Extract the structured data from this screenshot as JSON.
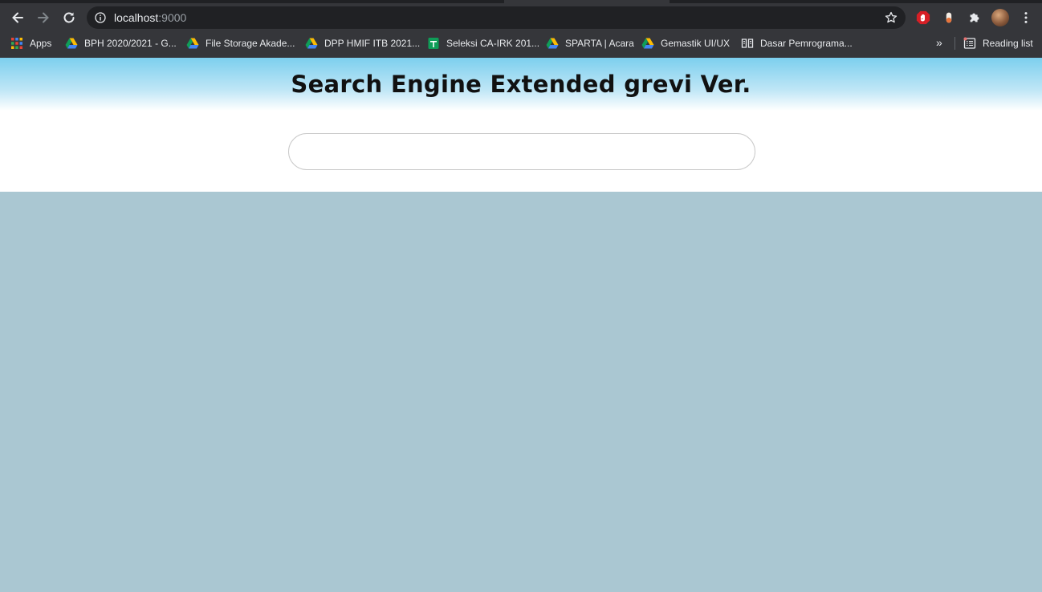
{
  "browser": {
    "url_host": "localhost",
    "url_port": ":9000",
    "bookmarks": [
      {
        "label": "Apps",
        "icon": "apps-grid-icon"
      },
      {
        "label": "BPH 2020/2021 - G...",
        "icon": "google-drive-icon"
      },
      {
        "label": "File Storage Akade...",
        "icon": "google-drive-icon"
      },
      {
        "label": "DPP HMIF ITB 2021...",
        "icon": "google-drive-icon"
      },
      {
        "label": "Seleksi CA-IRK 201...",
        "icon": "google-sheets-icon"
      },
      {
        "label": "SPARTA | Acara",
        "icon": "google-drive-icon"
      },
      {
        "label": "Gemastik UI/UX",
        "icon": "google-drive-icon"
      },
      {
        "label": "Dasar Pemrograma...",
        "icon": "book-icon"
      }
    ],
    "more_bookmarks": "»",
    "reading_list": "Reading list"
  },
  "page": {
    "title": "Search Engine Extended grevi Ver.",
    "search": {
      "value": "",
      "placeholder": ""
    }
  },
  "colors": {
    "header_gradient_top": "#7ccfee",
    "content_background": "#aac7d2"
  }
}
